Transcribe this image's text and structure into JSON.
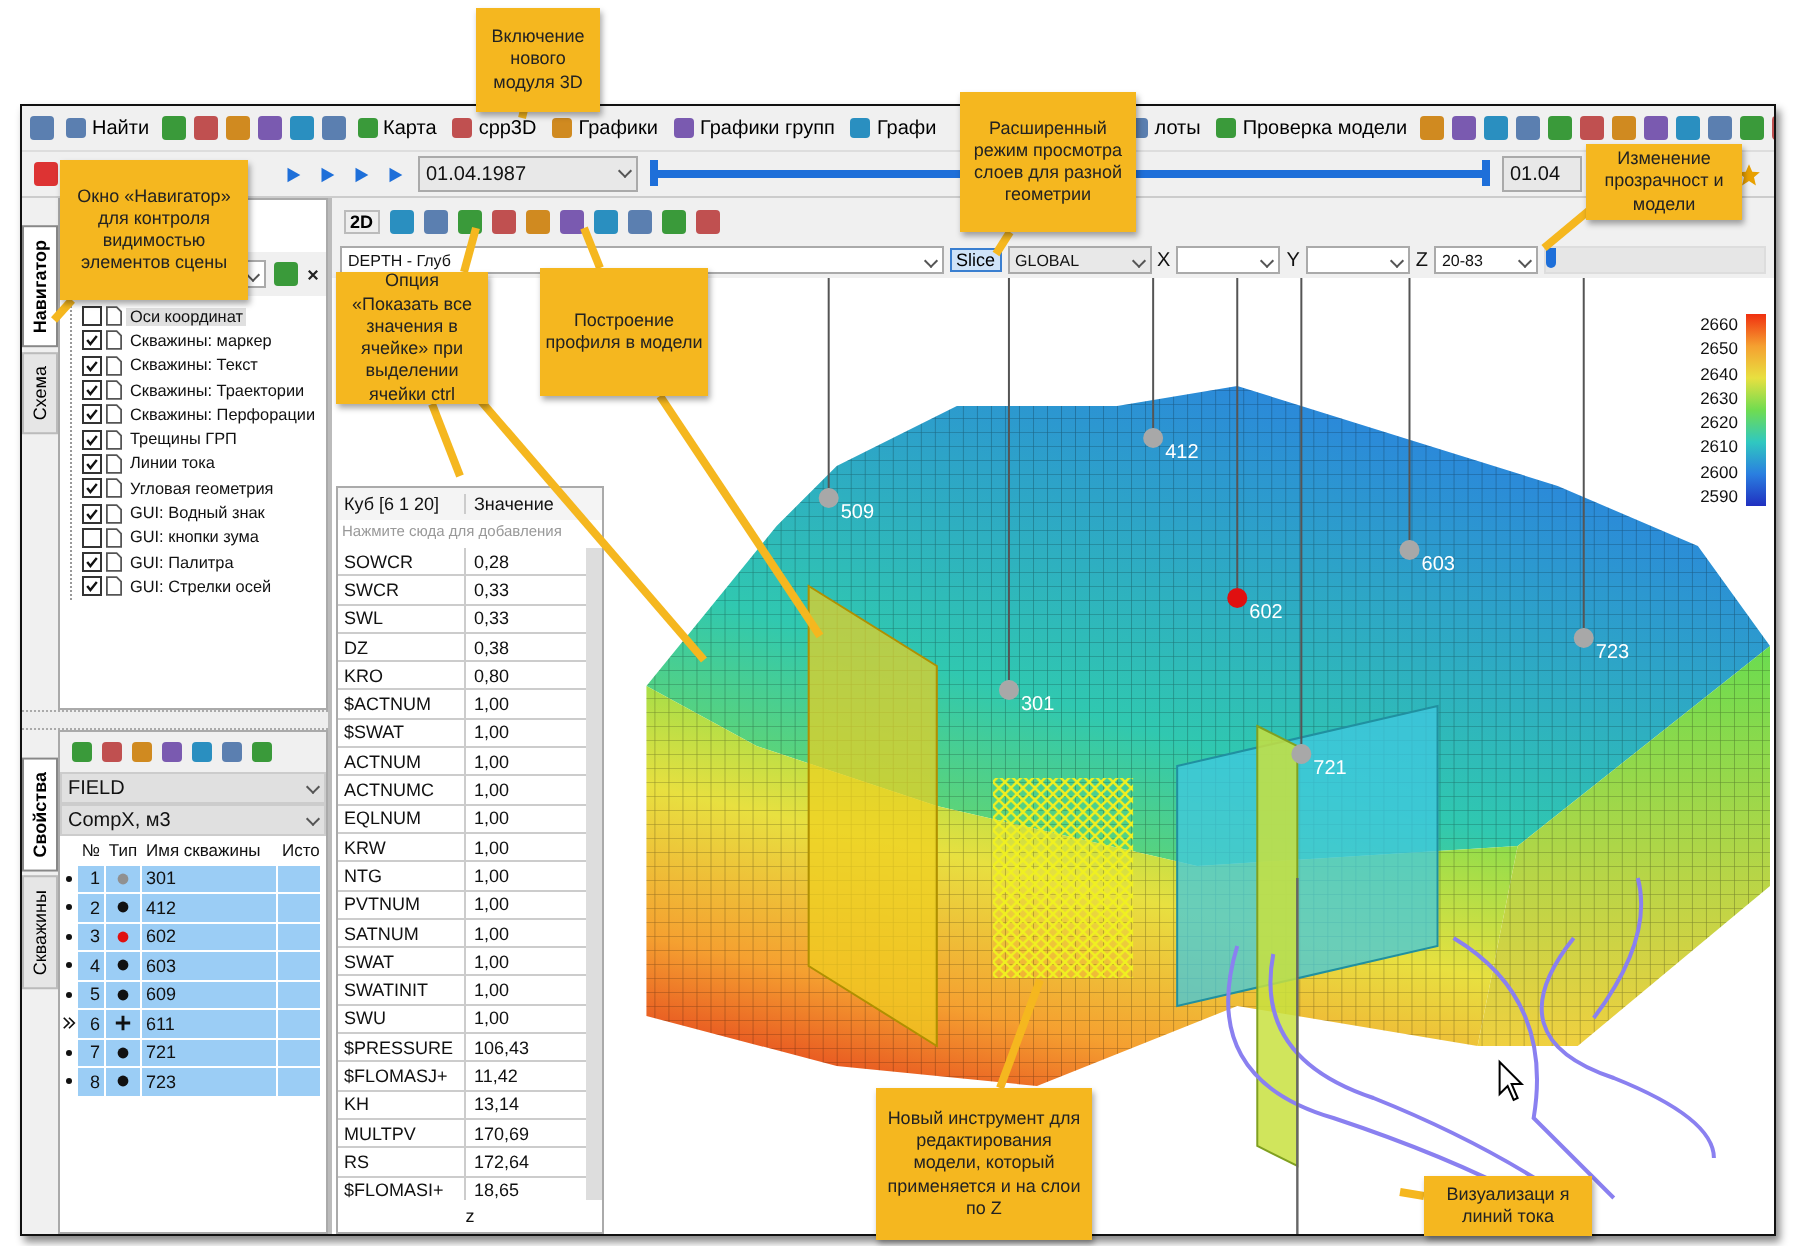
{
  "toolbar": {
    "items": [
      {
        "label": "Найти"
      },
      {
        "label": "Карта"
      },
      {
        "label": "cpp3D"
      },
      {
        "label": "Графики"
      },
      {
        "label": "Графики групп"
      },
      {
        "label": "Графи"
      },
      {
        "label": "лоты"
      },
      {
        "label": "Проверка модели"
      }
    ]
  },
  "timebar": {
    "start_date": "01.04.1987",
    "level": 1,
    "end_date": "01.04"
  },
  "navigator": {
    "tabs": [
      {
        "label": "Навигатор",
        "selected": true
      },
      {
        "label": "Схема",
        "selected": false
      }
    ],
    "items": [
      {
        "label": "Оси координат",
        "checked": false,
        "selected": true
      },
      {
        "label": "Скважины: маркер",
        "checked": true,
        "selected": false
      },
      {
        "label": "Скважины: Текст",
        "checked": true,
        "selected": false
      },
      {
        "label": "Скважины: Траектории",
        "checked": true,
        "selected": false
      },
      {
        "label": "Скважины: Перфорации",
        "checked": true,
        "selected": false
      },
      {
        "label": "Трещины ГРП",
        "checked": true,
        "selected": false
      },
      {
        "label": "Линии тока",
        "checked": true,
        "selected": false
      },
      {
        "label": "Угловая геометрия",
        "checked": true,
        "selected": false
      },
      {
        "label": "GUI: Водный знак",
        "checked": true,
        "selected": false
      },
      {
        "label": "GUI: кнопки зума",
        "checked": false,
        "selected": false
      },
      {
        "label": "GUI: Палитра",
        "checked": true,
        "selected": false
      },
      {
        "label": "GUI: Стрелки осей",
        "checked": true,
        "selected": false
      }
    ]
  },
  "wells_panel": {
    "tabs": [
      {
        "label": "Свойства",
        "selected": true
      },
      {
        "label": "Скважины",
        "selected": false
      }
    ],
    "field": "FIELD",
    "unit": "CompX, м3",
    "columns": [
      "№",
      "Тип",
      "Имя скважины",
      "Исто"
    ],
    "rows": [
      {
        "num": "1",
        "kind": "dot",
        "color": "#909090",
        "name": "301",
        "current": false,
        "selected": true
      },
      {
        "num": "2",
        "kind": "dot",
        "color": "#111111",
        "name": "412",
        "current": false,
        "selected": true
      },
      {
        "num": "3",
        "kind": "dot",
        "color": "#e01010",
        "name": "602",
        "current": false,
        "selected": true
      },
      {
        "num": "4",
        "kind": "dot",
        "color": "#111111",
        "name": "603",
        "current": false,
        "selected": true
      },
      {
        "num": "5",
        "kind": "dot",
        "color": "#111111",
        "name": "609",
        "current": false,
        "selected": true
      },
      {
        "num": "6",
        "kind": "plus",
        "color": "#111111",
        "name": "611",
        "current": true,
        "selected": true
      },
      {
        "num": "7",
        "kind": "dot",
        "color": "#111111",
        "name": "721",
        "current": false,
        "selected": true
      },
      {
        "num": "8",
        "kind": "dot",
        "color": "#111111",
        "name": "723",
        "current": false,
        "selected": true
      }
    ]
  },
  "view_toolbar": {
    "mode": "2D"
  },
  "filter_bar": {
    "property": "DEPTH   - Глуб",
    "slice": {
      "label": "Slice",
      "selected": true
    },
    "grid": "GLOBAL",
    "x_label": "X",
    "y_label": "Y",
    "z_label": "Z",
    "z_range": "20-83",
    "transparency": {
      "level": 0
    }
  },
  "cell_values": {
    "columns": [
      "Куб [6 1 20]",
      "Значение"
    ],
    "placeholder": "Нажмите сюда для добавления",
    "rows": [
      [
        "SOWCR",
        "0,28"
      ],
      [
        "SWCR",
        "0,33"
      ],
      [
        "SWL",
        "0,33"
      ],
      [
        "DZ",
        "0,38"
      ],
      [
        "KRO",
        "0,80"
      ],
      [
        "$ACTNUM",
        "1,00"
      ],
      [
        "$SWAT",
        "1,00"
      ],
      [
        "ACTNUM",
        "1,00"
      ],
      [
        "ACTNUMC",
        "1,00"
      ],
      [
        "EQLNUM",
        "1,00"
      ],
      [
        "KRW",
        "1,00"
      ],
      [
        "NTG",
        "1,00"
      ],
      [
        "PVTNUM",
        "1,00"
      ],
      [
        "SATNUM",
        "1,00"
      ],
      [
        "SWAT",
        "1,00"
      ],
      [
        "SWATINIT",
        "1,00"
      ],
      [
        "SWU",
        "1,00"
      ],
      [
        "$PRESSURE",
        "106,43"
      ],
      [
        "$FLOMASJ+",
        "11,42"
      ],
      [
        "KH",
        "13,14"
      ],
      [
        "MULTPV",
        "170,69"
      ],
      [
        "RS",
        "172,64"
      ],
      [
        "$FLOMASI+",
        "18,65"
      ]
    ],
    "footer": "z"
  },
  "scene": {
    "wells": [
      {
        "label": "509",
        "color": "#a8a8a8"
      },
      {
        "label": "412",
        "color": "#a8a8a8"
      },
      {
        "label": "603",
        "color": "#a8a8a8"
      },
      {
        "label": "602",
        "color": "#e01010"
      },
      {
        "label": "723",
        "color": "#a8a8a8"
      },
      {
        "label": "301",
        "color": "#a8a8a8"
      },
      {
        "label": "721",
        "color": "#a8a8a8"
      }
    ],
    "colorbar": [
      "2660",
      "2650",
      "2640",
      "2630",
      "2620",
      "2610",
      "2600",
      "2590"
    ]
  },
  "callouts": [
    "Включение нового модуля 3D",
    "Окно «Навигатор» для контроля видимостью элементов сцены",
    "Расширенный режим просмотра слоев для разной геометрии",
    "Изменение прозрачност и модели",
    "Опция «Показать все значения в ячейке» при выделении ячейки ctrl",
    "Построение профиля в модели",
    "Новый инструмент для редактирования модели, который применяется и на слои по Z",
    "Визуализаци я линий тока"
  ]
}
